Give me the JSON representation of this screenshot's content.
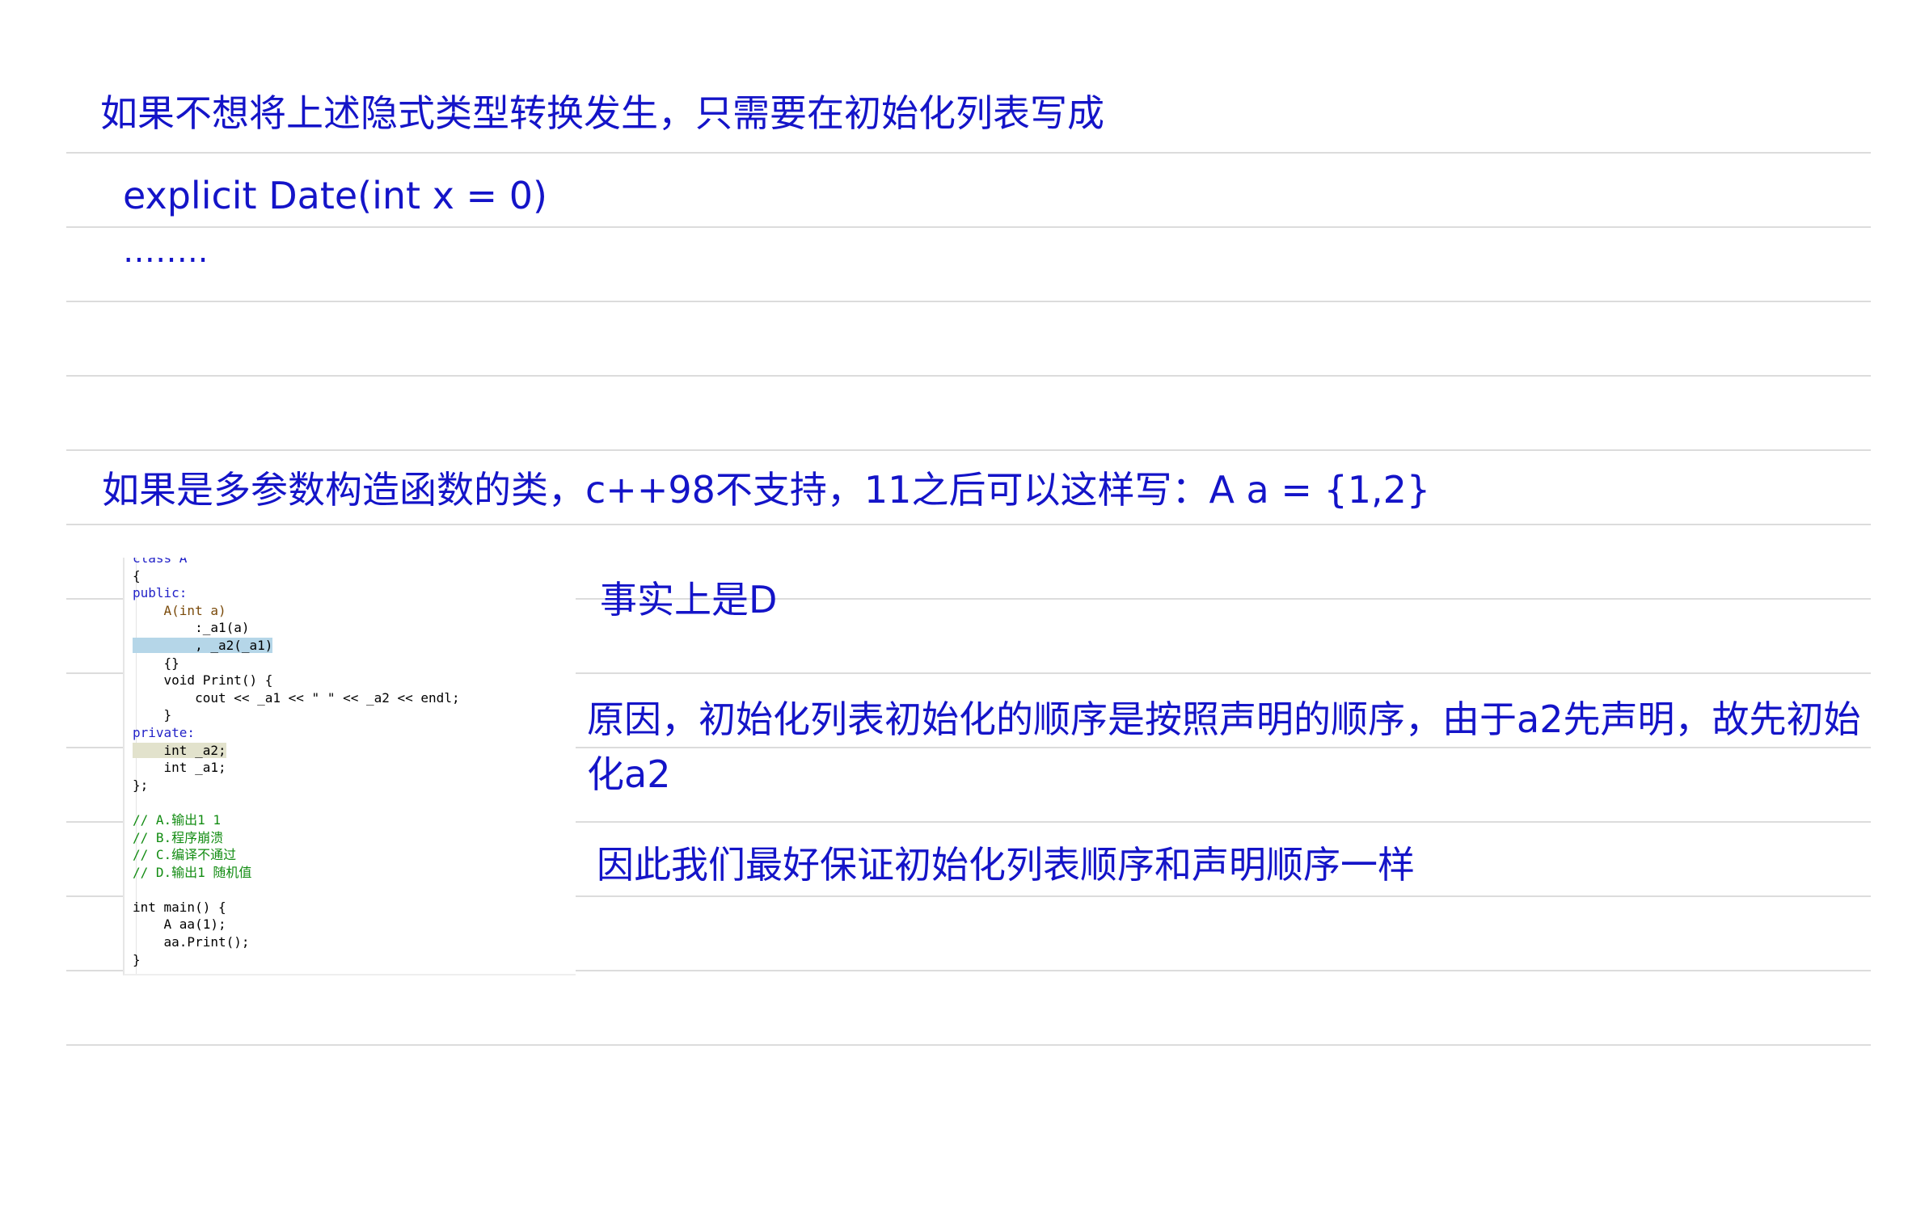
{
  "notes": {
    "line1": "如果不想将上述隐式类型转换发生，只需要在初始化列表写成",
    "code_explicit": "explicit Date(int x = 0)",
    "ellipsis": "……..",
    "line2": "如果是多参数构造函数的类，c++98不支持，11之后可以这样写：A a = {1,2}",
    "answer": "事实上是D",
    "reason": "原因，初始化列表初始化的顺序是按照声明的顺序，由于a2先声明，故先初始化a2",
    "conclusion": "因此我们最好保证初始化列表顺序和声明顺序一样"
  },
  "code_screenshot": {
    "lines": [
      "class A",
      "{",
      "public:",
      "    A(int a)",
      "        :_a1(a)",
      "        , _a2(_a1)",
      "    {}",
      "    void Print() {",
      "        cout << _a1 << \" \" << _a2 << endl;",
      "    }",
      "private:",
      "    int _a2;",
      "    int _a1;",
      "};",
      "",
      "// A.输出1 1",
      "// B.程序崩溃",
      "// C.编译不通过",
      "// D.输出1 随机值",
      "",
      "int main() {",
      "    A aa(1);",
      "    aa.Print();",
      "}"
    ]
  },
  "colors": {
    "note_text": "#1414c8",
    "rule": "#dcdcdc",
    "code_keyword": "#2222c8",
    "code_comment": "#128c12"
  }
}
